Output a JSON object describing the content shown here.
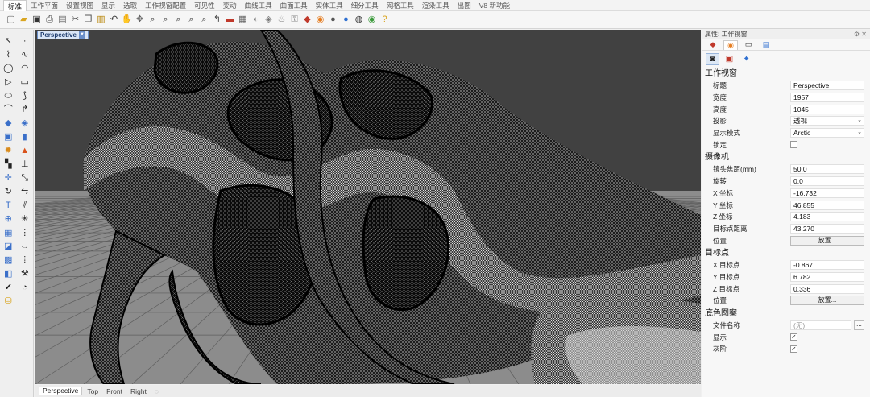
{
  "menu_tabs": [
    "标准",
    "工作平面",
    "设置视图",
    "显示",
    "选取",
    "工作视窗配置",
    "可见性",
    "变动",
    "曲线工具",
    "曲面工具",
    "实体工具",
    "细分工具",
    "网格工具",
    "渲染工具",
    "出图",
    "V8 新功能"
  ],
  "viewport": {
    "title": "Perspective",
    "dropdown_icon": "chevron-down-icon",
    "background_color": "#7a7a7a",
    "grid_color": "#555555"
  },
  "view_tabs": [
    "Perspective",
    "Top",
    "Front",
    "Right"
  ],
  "panel": {
    "header": "属性: 工作视窗",
    "sections": {
      "viewport": {
        "title": "工作视窗",
        "title_label": "标题",
        "title_value": "Perspective",
        "width_label": "宽度",
        "width_value": "1957",
        "height_label": "高度",
        "height_value": "1045",
        "projection_label": "投影",
        "projection_value": "透视",
        "display_mode_label": "显示模式",
        "display_mode_value": "Arctic",
        "locked_label": "锁定"
      },
      "camera": {
        "title": "摄像机",
        "lens_label": "镜头焦距(mm)",
        "lens_value": "50.0",
        "rotation_label": "旋转",
        "rotation_value": "0.0",
        "x_label": "X 坐标",
        "x_value": "-16.732",
        "y_label": "Y 坐标",
        "y_value": "46.855",
        "z_label": "Z 坐标",
        "z_value": "4.183",
        "target_dist_label": "目标点距离",
        "target_dist_value": "43.270",
        "position_label": "位置",
        "position_button": "放置..."
      },
      "target": {
        "title": "目标点",
        "x_label": "X 目标点",
        "x_value": "-0.867",
        "y_label": "Y 目标点",
        "y_value": "6.782",
        "z_label": "Z 目标点",
        "z_value": "0.336",
        "position_label": "位置",
        "position_button": "放置..."
      },
      "background": {
        "title": "底色图案",
        "filename_label": "文件名称",
        "filename_value": "(无)",
        "browse_button": "...",
        "show_label": "显示",
        "gray_label": "灰阶"
      }
    }
  }
}
